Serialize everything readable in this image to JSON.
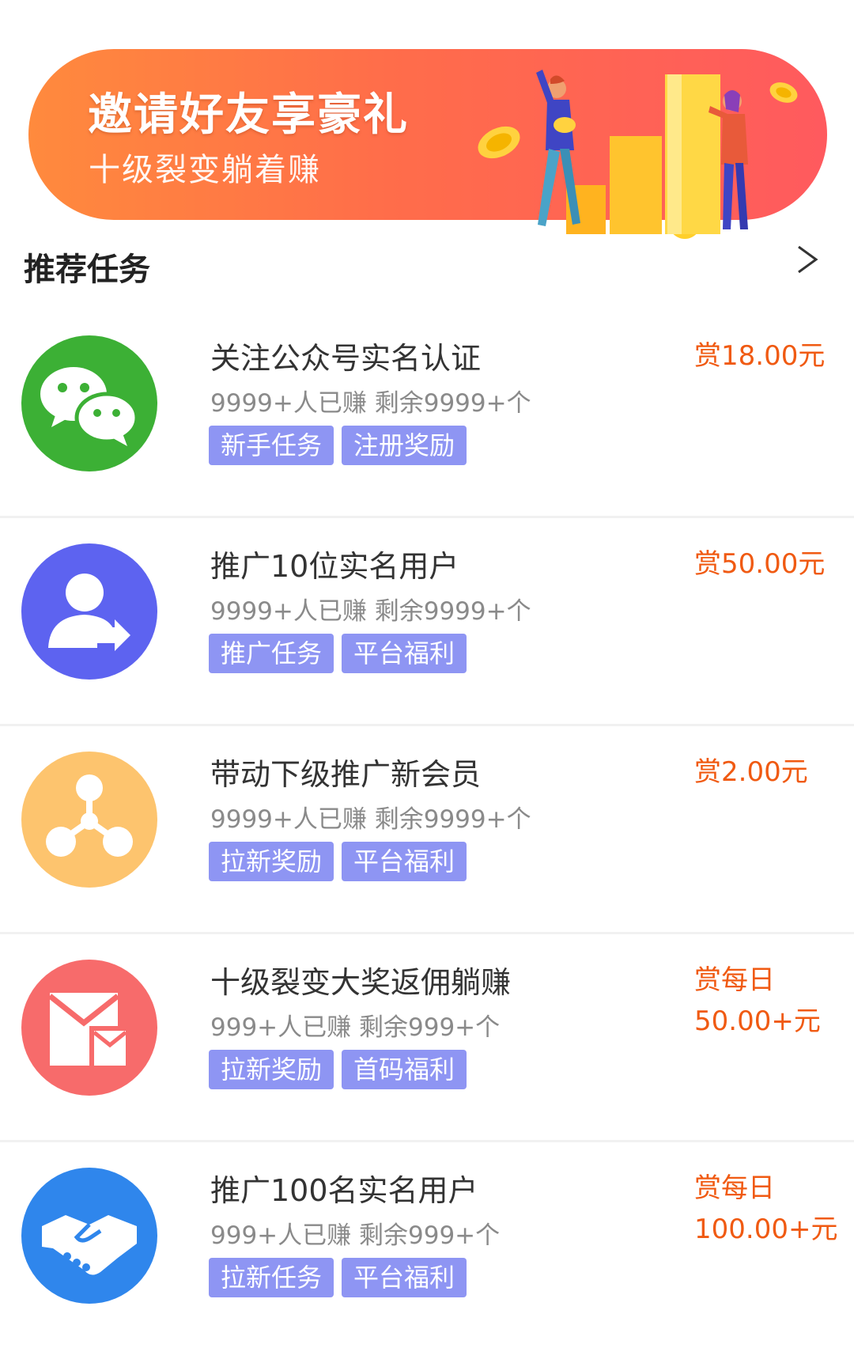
{
  "banner": {
    "title": "邀请好友享豪礼",
    "subtitle": "十级裂变躺着赚"
  },
  "section": {
    "title": "推荐任务",
    "arrow_icon": "chevron-right-icon"
  },
  "tasks": [
    {
      "icon": "wechat-icon",
      "icon_color": "#3cb035",
      "title": "关注公众号实名认证",
      "stats": "9999+人已赚 剩余9999+个",
      "tags": [
        "新手任务",
        "注册奖励"
      ],
      "reward_line1": "赏18.00元",
      "reward_line2": ""
    },
    {
      "icon": "user-share-icon",
      "icon_color": "#5d63f0",
      "title": "推广10位实名用户",
      "stats": "9999+人已赚 剩余9999+个",
      "tags": [
        "推广任务",
        "平台福利"
      ],
      "reward_line1": "赏50.00元",
      "reward_line2": ""
    },
    {
      "icon": "network-icon",
      "icon_color": "#fdc46e",
      "title": "带动下级推广新会员",
      "stats": "9999+人已赚 剩余9999+个",
      "tags": [
        "拉新奖励",
        "平台福利"
      ],
      "reward_line1": "赏2.00元",
      "reward_line2": ""
    },
    {
      "icon": "envelope-icon",
      "icon_color": "#f76b6b",
      "title": "十级裂变大奖返佣躺赚",
      "stats": "999+人已赚 剩余999+个",
      "tags": [
        "拉新奖励",
        "首码福利"
      ],
      "reward_line1": "赏每日",
      "reward_line2": "50.00+元"
    },
    {
      "icon": "handshake-icon",
      "icon_color": "#2f86ec",
      "title": "推广100名实名用户",
      "stats": "999+人已赚 剩余999+个",
      "tags": [
        "拉新任务",
        "平台福利"
      ],
      "reward_line1": "赏每日",
      "reward_line2": "100.00+元"
    }
  ]
}
